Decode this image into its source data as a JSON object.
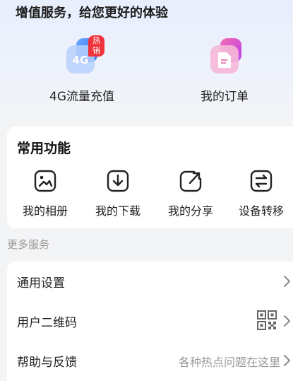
{
  "header": {
    "title": "增值服务，给您更好的体验"
  },
  "services": [
    {
      "label": "4G流量充值",
      "icon": "4g-data-icon",
      "badge": "热销"
    },
    {
      "label": "我的订单",
      "icon": "order-document-icon"
    }
  ],
  "common": {
    "title": "常用功能",
    "items": [
      {
        "label": "我的相册",
        "icon": "photo-album-icon"
      },
      {
        "label": "我的下载",
        "icon": "download-icon"
      },
      {
        "label": "我的分享",
        "icon": "share-icon"
      },
      {
        "label": "设备转移",
        "icon": "device-transfer-icon"
      }
    ]
  },
  "more": {
    "title": "更多服务",
    "rows": [
      {
        "label": "通用设置"
      },
      {
        "label": "用户二维码",
        "icon": "qr-code-icon"
      },
      {
        "label": "帮助与反馈",
        "hint": "各种热点问题在这里"
      }
    ]
  },
  "colors": {
    "accent_blue": "#3a7bf5",
    "accent_pink": "#e0529a",
    "hot_badge": "#f0323a"
  }
}
